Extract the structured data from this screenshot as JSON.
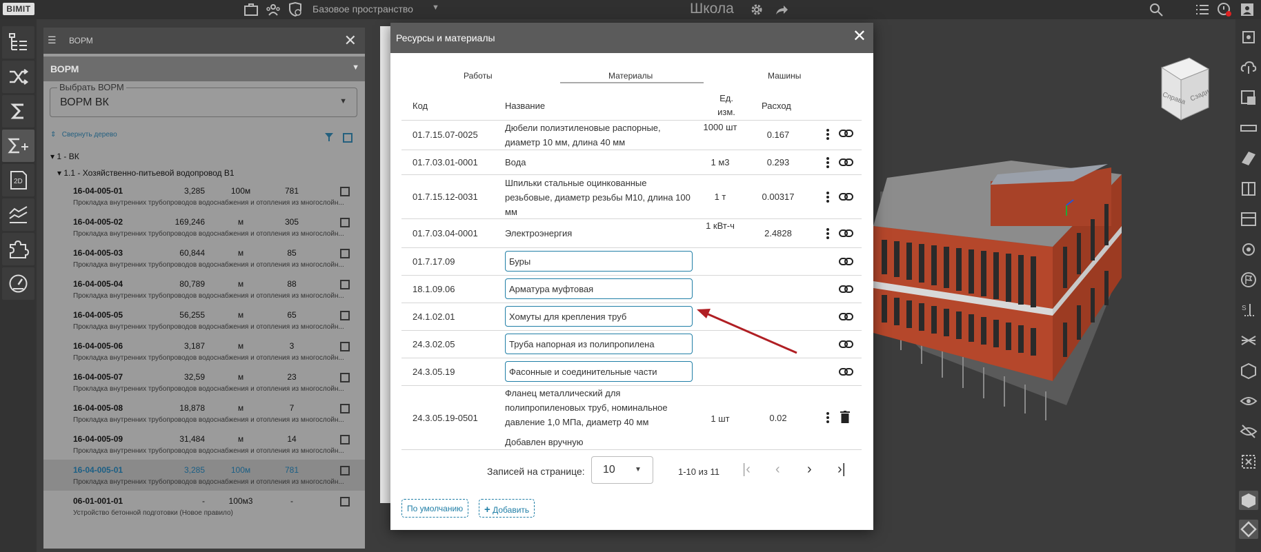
{
  "topbar": {
    "logo": "BIMIT",
    "space": "Базовое пространство",
    "title": "Школа"
  },
  "borm_panel": {
    "header_title": "ВОРМ",
    "section_title": "ВОРМ",
    "select_label": "Выбрать ВОРМ",
    "select_value": "ВОРМ ВК",
    "collapse_label": "Свернуть дерево",
    "tree_level1": "1 - ВК",
    "tree_level2": "1.1 - Хозяйственно-питьевой водопровод В1",
    "rows": [
      {
        "code": "16-04-005-01",
        "num": "3,285",
        "unit": "100м",
        "qty": "781",
        "desc": "Прокладка внутренних трубопроводов водоснабжения и отопления из многослойн..."
      },
      {
        "code": "16-04-005-02",
        "num": "169,246",
        "unit": "м",
        "qty": "305",
        "desc": "Прокладка внутренних трубопроводов водоснабжения и отопления из многослойн..."
      },
      {
        "code": "16-04-005-03",
        "num": "60,844",
        "unit": "м",
        "qty": "85",
        "desc": "Прокладка внутренних трубопроводов водоснабжения и отопления из многослойн..."
      },
      {
        "code": "16-04-005-04",
        "num": "80,789",
        "unit": "м",
        "qty": "88",
        "desc": "Прокладка внутренних трубопроводов водоснабжения и отопления из многослойн..."
      },
      {
        "code": "16-04-005-05",
        "num": "56,255",
        "unit": "м",
        "qty": "65",
        "desc": "Прокладка внутренних трубопроводов водоснабжения и отопления из многослойн..."
      },
      {
        "code": "16-04-005-06",
        "num": "3,187",
        "unit": "м",
        "qty": "3",
        "desc": "Прокладка внутренних трубопроводов водоснабжения и отопления из многослойн..."
      },
      {
        "code": "16-04-005-07",
        "num": "32,59",
        "unit": "м",
        "qty": "23",
        "desc": "Прокладка внутренних трубопроводов водоснабжения и отопления из многослойн..."
      },
      {
        "code": "16-04-005-08",
        "num": "18,878",
        "unit": "м",
        "qty": "7",
        "desc": "Прокладка внутренних трубопроводов водоснабжения и отопления из многослойн..."
      },
      {
        "code": "16-04-005-09",
        "num": "31,484",
        "unit": "м",
        "qty": "14",
        "desc": "Прокладка внутренних трубопроводов водоснабжения и отопления из многослойн..."
      },
      {
        "code": "16-04-005-01",
        "num": "3,285",
        "unit": "100м",
        "qty": "781",
        "desc": "Прокладка внутренних трубопроводов водоснабжения и отопления из многослойн..."
      },
      {
        "code": "06-01-001-01",
        "num": "-",
        "unit": "100м3",
        "qty": "-",
        "desc": "Устройство бетонной подготовки (Новое правило)"
      }
    ]
  },
  "modal": {
    "title": "Ресурсы и материалы",
    "tabs": [
      "Работы",
      "Материалы",
      "Машины"
    ],
    "active_tab": "Материалы",
    "headers": {
      "code": "Код",
      "name": "Название",
      "unit_line1": "Ед.",
      "unit_line2": "изм.",
      "consumption": "Расход"
    },
    "rows": [
      {
        "code": "01.7.15.07-0025",
        "name": "Дюбели полиэтиленовые распорные, диаметр 10 мм, длина 40 мм",
        "unit": "1000 шт",
        "rate": "0.167"
      },
      {
        "code": "01.7.03.01-0001",
        "name": "Вода",
        "unit": "1 м3",
        "rate": "0.293"
      },
      {
        "code": "01.7.15.12-0031",
        "name": "Шпильки стальные оцинкованные резьбовые, диаметр резьбы М10, длина 100 мм",
        "unit": "1 т",
        "rate": "0.00317"
      },
      {
        "code": "01.7.03.04-0001",
        "name": "Электроэнергия",
        "unit": "1 кВт-ч",
        "rate": "2.4828"
      }
    ],
    "input_rows": [
      {
        "code": "01.7.17.09",
        "value": "Буры"
      },
      {
        "code": "18.1.09.06",
        "value": "Арматура муфтовая"
      },
      {
        "code": "24.1.02.01",
        "value": "Хомуты для крепления труб"
      },
      {
        "code": "24.3.02.05",
        "value": "Труба напорная из полипропилена"
      },
      {
        "code": "24.3.05.19",
        "value": "Фасонные и соединительные части"
      }
    ],
    "manual_row": {
      "code": "24.3.05.19-0501",
      "name": "Фланец металлический для полипропиленовых труб, номинальное давление 1,0 МПа, диаметр 40 мм",
      "unit": "1 шт",
      "rate": "0.02",
      "note": "Добавлен вручную"
    },
    "pager": {
      "label": "Записей на странице:",
      "per_page": "10",
      "range": "1-10 из 11"
    },
    "default_button": "По умолчанию",
    "add_button": "Добавить"
  },
  "viewcube": {
    "face_a": "Справа",
    "face_b": "Сзади"
  },
  "colors": {
    "accent": "#1f7ea6",
    "arrow": "#b01f24"
  }
}
